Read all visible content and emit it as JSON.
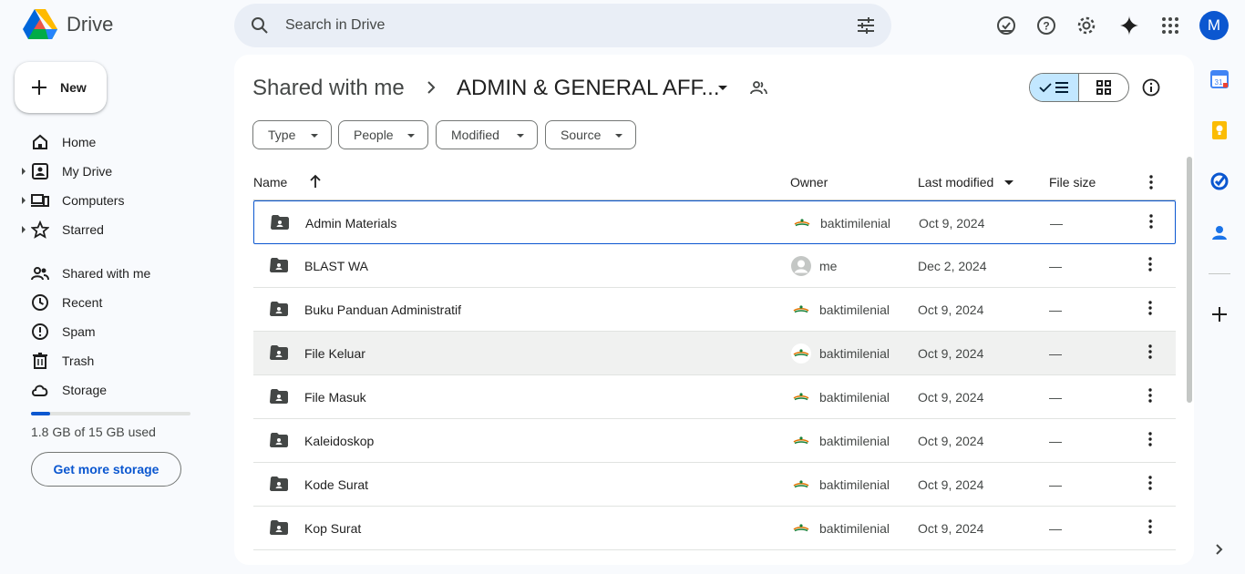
{
  "app": {
    "name": "Drive"
  },
  "search": {
    "placeholder": "Search in Drive"
  },
  "header": {
    "avatar_initial": "M"
  },
  "sidebar": {
    "new_label": "New",
    "items": [
      {
        "label": "Home",
        "icon": "home-icon",
        "expandable": false
      },
      {
        "label": "My Drive",
        "icon": "my-drive-icon",
        "expandable": true
      },
      {
        "label": "Computers",
        "icon": "computers-icon",
        "expandable": true
      },
      {
        "label": "Starred",
        "icon": "star-icon",
        "expandable": true
      },
      {
        "label": "Shared with me",
        "icon": "shared-icon",
        "expandable": false
      },
      {
        "label": "Recent",
        "icon": "clock-icon",
        "expandable": false
      },
      {
        "label": "Spam",
        "icon": "spam-icon",
        "expandable": false
      },
      {
        "label": "Trash",
        "icon": "trash-icon",
        "expandable": false
      },
      {
        "label": "Storage",
        "icon": "cloud-icon",
        "expandable": false
      }
    ],
    "storage_used_fraction": 0.12,
    "storage_text": "1.8 GB of 15 GB used",
    "get_storage_label": "Get more storage"
  },
  "breadcrumb": {
    "root": "Shared with me",
    "current": "ADMIN & GENERAL AFF..."
  },
  "filters": [
    "Type",
    "People",
    "Modified",
    "Source"
  ],
  "table": {
    "headers": {
      "name": "Name",
      "owner": "Owner",
      "modified": "Last modified",
      "size": "File size"
    },
    "rows": [
      {
        "name": "Admin Materials",
        "owner": "baktimilenial",
        "modified": "Oct 9, 2024",
        "size": "—"
      },
      {
        "name": "BLAST WA",
        "owner": "me",
        "modified": "Dec 2, 2024",
        "size": "—"
      },
      {
        "name": "Buku Panduan Administratif",
        "owner": "baktimilenial",
        "modified": "Oct 9, 2024",
        "size": "—"
      },
      {
        "name": "File Keluar",
        "owner": "baktimilenial",
        "modified": "Oct 9, 2024",
        "size": "—"
      },
      {
        "name": "File Masuk",
        "owner": "baktimilenial",
        "modified": "Oct 9, 2024",
        "size": "—"
      },
      {
        "name": "Kaleidoskop",
        "owner": "baktimilenial",
        "modified": "Oct 9, 2024",
        "size": "—"
      },
      {
        "name": "Kode Surat",
        "owner": "baktimilenial",
        "modified": "Oct 9, 2024",
        "size": "—"
      },
      {
        "name": "Kop Surat",
        "owner": "baktimilenial",
        "modified": "Oct 9, 2024",
        "size": "—"
      }
    ]
  },
  "colors": {
    "accent": "#0b57d0",
    "selected_view": "#c2e7ff",
    "background": "#f8fafd"
  }
}
